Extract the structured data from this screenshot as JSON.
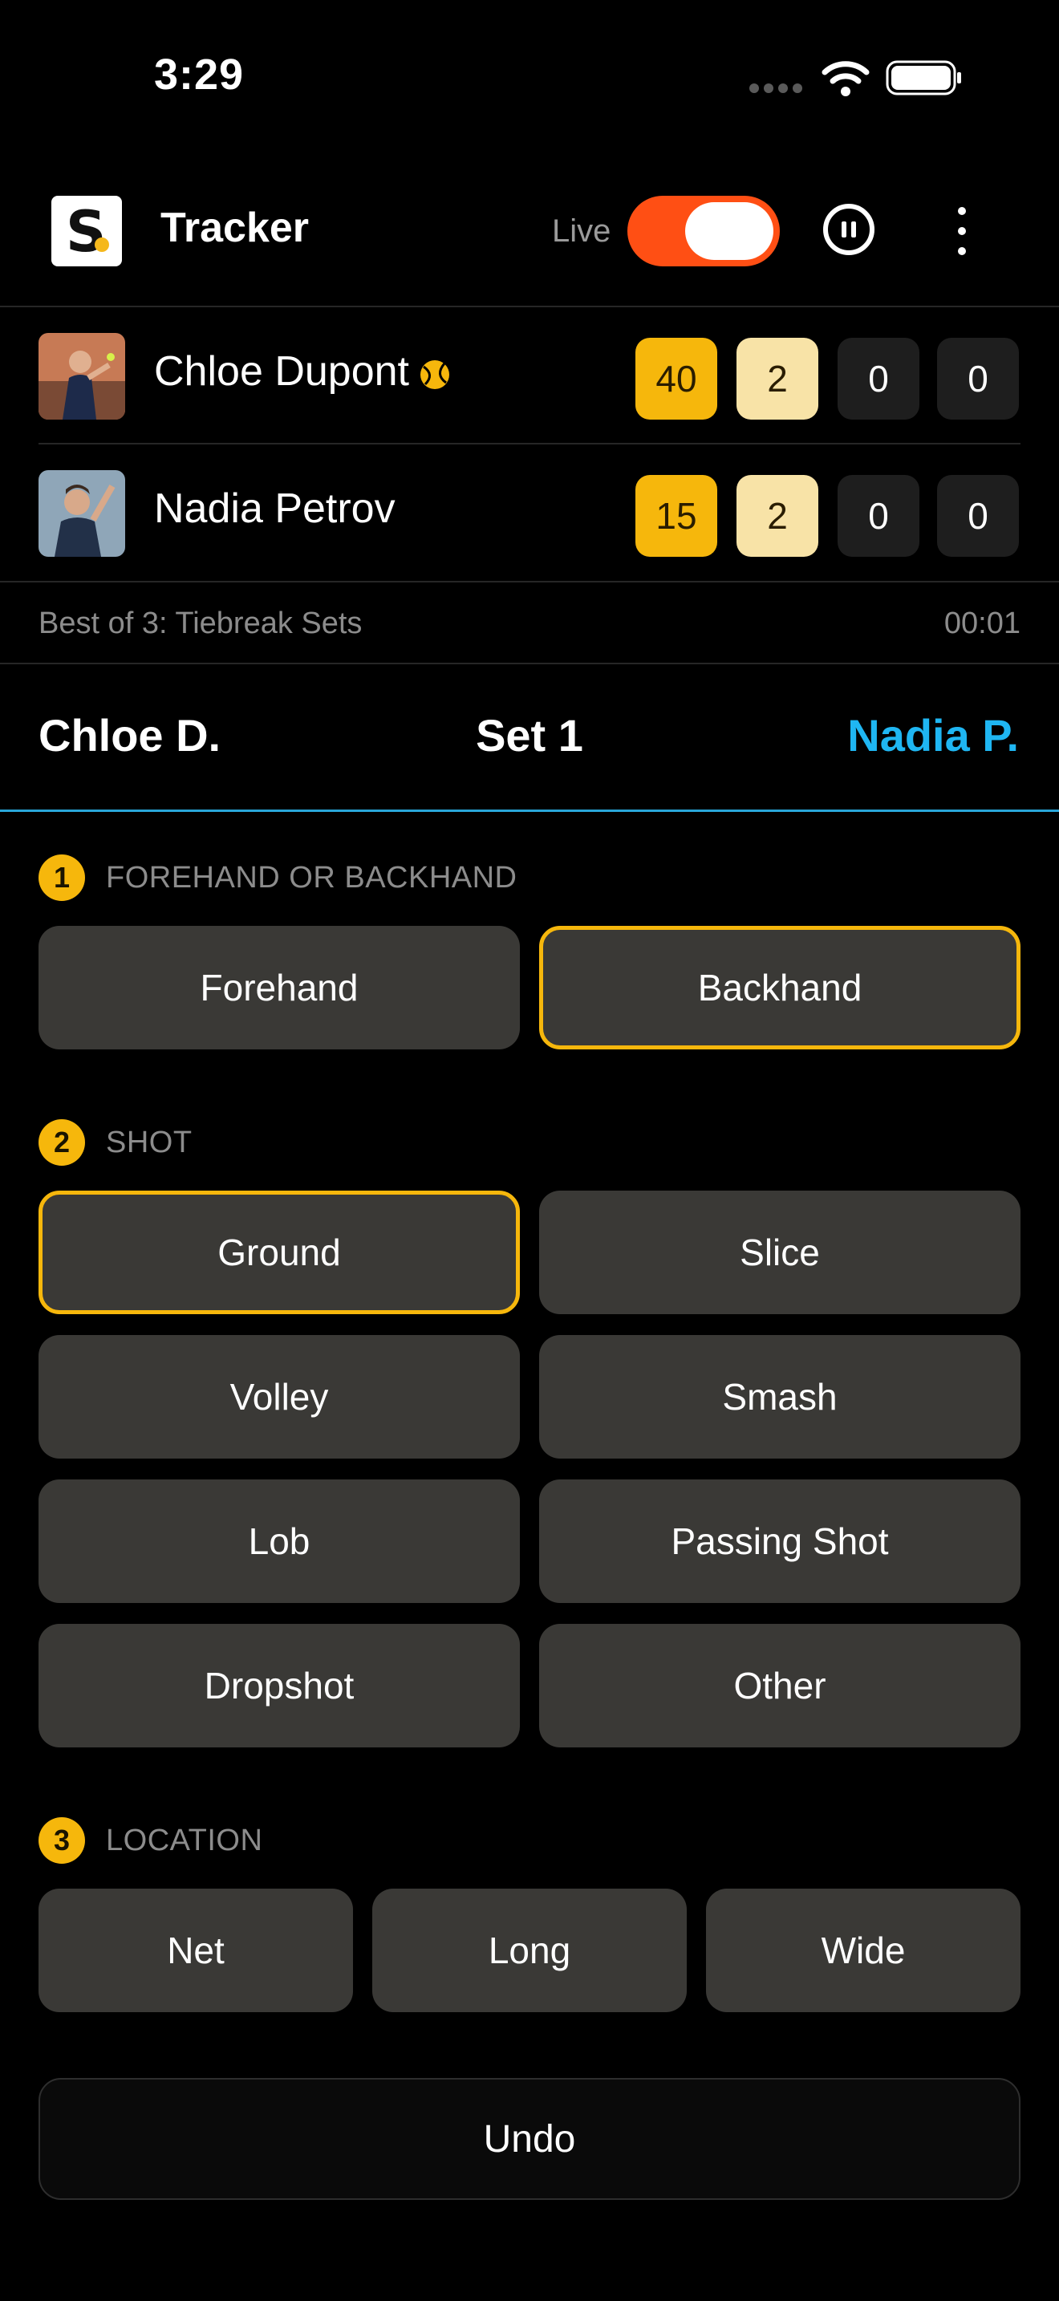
{
  "status_bar": {
    "time": "3:29"
  },
  "header": {
    "app_title": "Tracker",
    "logo_letter": "S",
    "live_label": "Live",
    "live_on": true
  },
  "players": [
    {
      "name": "Chloe Dupont",
      "serving": true,
      "game": "40",
      "set1": "2",
      "set2": "0",
      "set3": "0"
    },
    {
      "name": "Nadia Petrov",
      "serving": false,
      "game": "15",
      "set1": "2",
      "set2": "0",
      "set3": "0"
    }
  ],
  "match": {
    "format": "Best of 3: Tiebreak Sets",
    "timer": "00:01"
  },
  "set_header": {
    "left_player": "Chloe D.",
    "set_label": "Set 1",
    "right_player": "Nadia P."
  },
  "sections": {
    "stroke": {
      "step": "1",
      "title": "FOREHAND OR BACKHAND",
      "options": [
        "Forehand",
        "Backhand"
      ],
      "selected": "Backhand"
    },
    "shot": {
      "step": "2",
      "title": "SHOT",
      "options": [
        "Ground",
        "Slice",
        "Volley",
        "Smash",
        "Lob",
        "Passing Shot",
        "Dropshot",
        "Other"
      ],
      "selected": "Ground"
    },
    "location": {
      "step": "3",
      "title": "LOCATION",
      "options": [
        "Net",
        "Long",
        "Wide"
      ]
    }
  },
  "undo_label": "Undo",
  "colors": {
    "accent_yellow": "#f6b70c",
    "live_toggle": "#ff4f14",
    "set_blue": "#1fb6f2"
  }
}
